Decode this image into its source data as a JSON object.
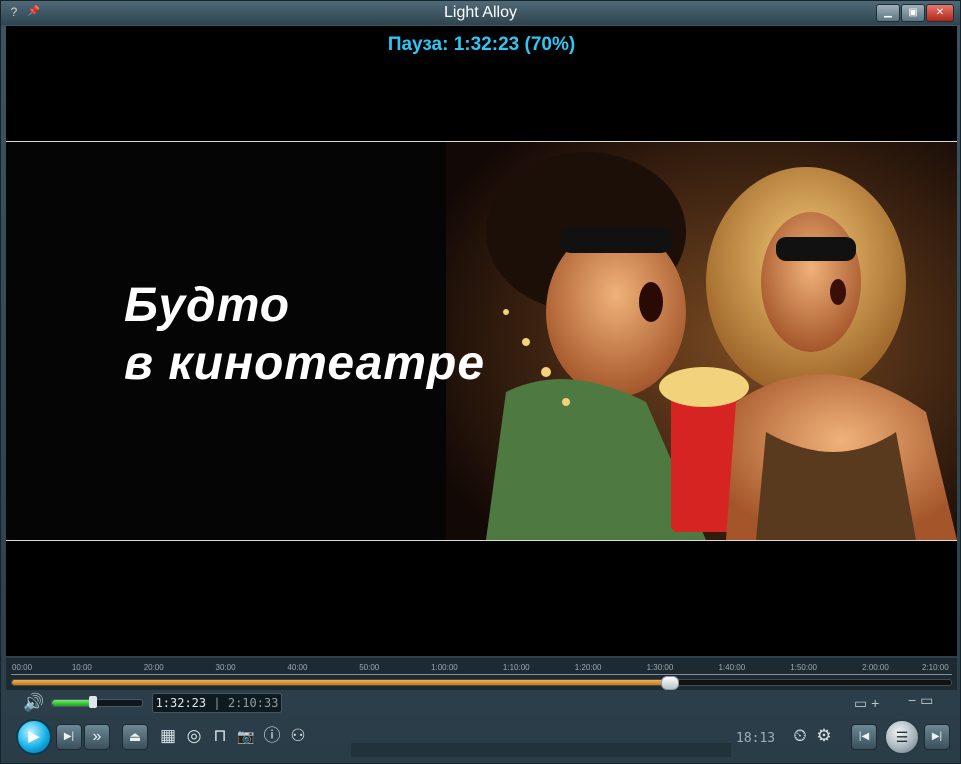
{
  "window": {
    "title": "Light Alloy",
    "help_glyph": "?",
    "pin_glyph": "📌",
    "minimize_glyph": "▁",
    "maximize_glyph": "▣",
    "close_glyph": "✕"
  },
  "osd": {
    "status_text": "Пауза: 1:32:23 (70%)"
  },
  "video": {
    "poster_line1": "Будто",
    "poster_line2": "в кинотеатре"
  },
  "timeline": {
    "tick_labels": [
      "00:00",
      "10:00",
      "20:00",
      "30:00",
      "40:00",
      "50:00",
      "1:00:00",
      "1:10:00",
      "1:20:00",
      "1:30:00",
      "1:40:00",
      "1:50:00",
      "2:00:00",
      "2:10:00"
    ],
    "progress_fraction": 0.7
  },
  "volume": {
    "level_fraction": 0.45
  },
  "time_display": {
    "current": "1:32:23",
    "separator": "|",
    "total": "2:10:33"
  },
  "controls": {
    "play_glyph": "▶",
    "frame_step_glyph": "▶|",
    "fast_forward_glyph": "»",
    "eject_glyph": "⏏",
    "film_glyph": "▦",
    "disc_glyph": "◎",
    "subtitle_glyph": "⊓",
    "camera_glyph": "📷",
    "info_glyph": "ⓘ",
    "network_glyph": "⚇",
    "timer_glyph": "⏲",
    "settings_glyph": "⚙",
    "prev_glyph": "|◀",
    "playlist_glyph": "☰",
    "next_glyph": "▶|",
    "screen_glyph": "▭ +",
    "minus_glyph": "− ▭"
  },
  "clock": "18:13",
  "colors": {
    "osd": "#2ec7f5",
    "progress": "#e89a30",
    "volume": "#3fd13f",
    "play_button": "#14b0e8"
  }
}
